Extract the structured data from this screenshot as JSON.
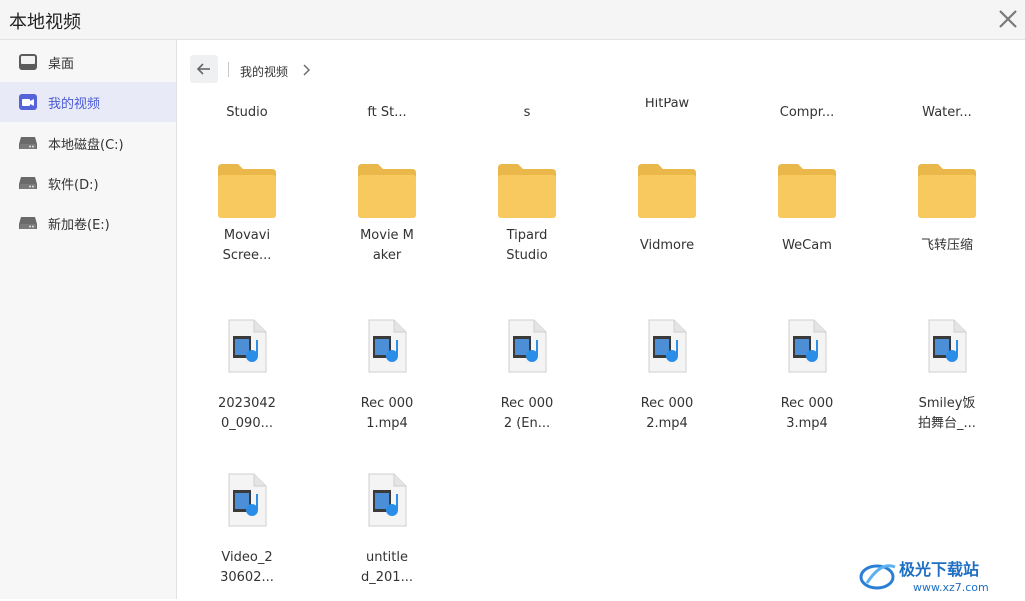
{
  "window": {
    "title": "本地视频"
  },
  "sidebar": {
    "items": [
      {
        "label": "桌面",
        "icon": "desktop-icon",
        "active": false
      },
      {
        "label": "我的视频",
        "icon": "video-icon",
        "active": true
      },
      {
        "label": "本地磁盘(C:)",
        "icon": "drive-icon",
        "active": false
      },
      {
        "label": "软件(D:)",
        "icon": "drive-icon",
        "active": false
      },
      {
        "label": "新加卷(E:)",
        "icon": "drive-icon",
        "active": false
      }
    ]
  },
  "breadcrumb": {
    "current": "我的视频"
  },
  "partial_row": [
    "Studio",
    "ft St...",
    "s",
    "HitPaw",
    "Compr...",
    "Water..."
  ],
  "folders": [
    {
      "label": "Movavi\nScree..."
    },
    {
      "label": "Movie M\naker"
    },
    {
      "label": "Tipard\nStudio"
    },
    {
      "label": "Vidmore"
    },
    {
      "label": "WeCam"
    },
    {
      "label": "飞转压缩"
    }
  ],
  "files": [
    {
      "label": "2023042\n0_090..."
    },
    {
      "label": "Rec 000\n1.mp4"
    },
    {
      "label": "Rec 000\n2 (En..."
    },
    {
      "label": "Rec 000\n2.mp4"
    },
    {
      "label": "Rec 000\n3.mp4"
    },
    {
      "label": "Smiley饭\n拍舞台_..."
    },
    {
      "label": "Video_2\n30602..."
    },
    {
      "label": "untitle\nd_201..."
    }
  ],
  "watermark": {
    "text": "极光下载站",
    "url": "www.xz7.com"
  },
  "colors": {
    "accent": "#4c5bd4",
    "folder": "#f7c95e",
    "folder_back": "#eab74a"
  }
}
